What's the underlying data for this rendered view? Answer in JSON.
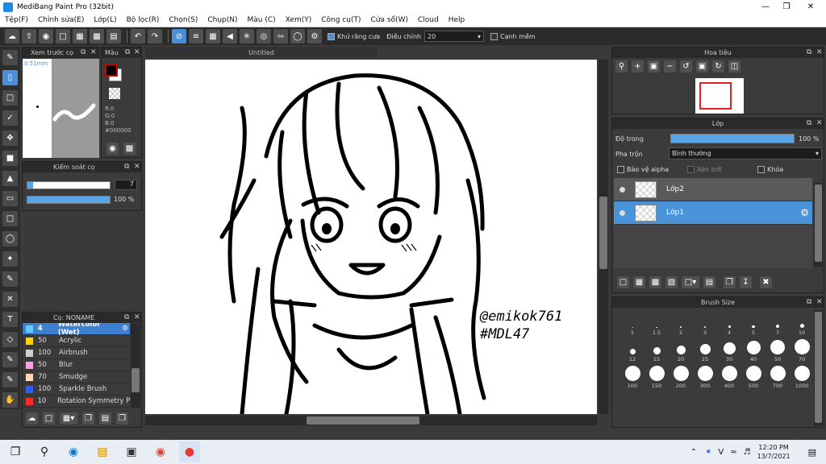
{
  "window": {
    "title": "MediBang Paint Pro (32bit)"
  },
  "menu": [
    "Tệp(F)",
    "Chỉnh sửa(E)",
    "Lớp(L)",
    "Bộ lọc(R)",
    "Chọn(S)",
    "Chụp(N)",
    "Màu (C)",
    "Xem(Y)",
    "Công cụ(T)",
    "Cửa sổ(W)",
    "Cloud",
    "Help"
  ],
  "toolbar": {
    "antialias_label": "Khử răng cưa",
    "adjust_label": "Điều chỉnh",
    "adjust_value": "20",
    "snap_label": "Cạnh mềm"
  },
  "brush_preview": {
    "title": "Xem trước cọ",
    "size": "0.51mm"
  },
  "color_panel": {
    "title": "Màu",
    "r": "R:0",
    "g": "G:0",
    "b": "B:0",
    "hex": "#000000",
    "fg_color": "#000000",
    "bg_color": "#ffffff"
  },
  "brush_control": {
    "title": "Kiểm soát cọ",
    "size_value": "7",
    "opacity_value": "100 %",
    "size_fraction": 0.07,
    "opacity_fraction": 1.0
  },
  "brush_list": {
    "title": "Cọ: NONAME",
    "items": [
      {
        "size": "4",
        "name": "Watercolor (Wet)",
        "color": "#6ec6ff",
        "selected": true
      },
      {
        "size": "50",
        "name": "Acrylic",
        "color": "#ffd400"
      },
      {
        "size": "100",
        "name": "Airbrush",
        "color": "#cfcfcf"
      },
      {
        "size": "50",
        "name": "Blur",
        "color": "#ff9ee6"
      },
      {
        "size": "70",
        "name": "Smudge",
        "color": "#ffd8b8"
      },
      {
        "size": "100",
        "name": "Sparkle Brush",
        "color": "#2f5bff"
      },
      {
        "size": "10",
        "name": "Rotation Symmetry Pe",
        "color": "#ff2a2a"
      }
    ]
  },
  "document": {
    "tab": "Untitled",
    "signature": "@emikok761\n#MDL47"
  },
  "navigator": {
    "title": "Hoa tiêu"
  },
  "layer_panel": {
    "title": "Lớp",
    "opacity_label": "Độ trong",
    "opacity_value": "100 %",
    "opacity_fraction": 1.0,
    "blend_label": "Pha trộn",
    "blend_value": "Bình thường",
    "protect_alpha": "Bảo vệ alpha",
    "clipping": "Xén bớt",
    "lock": "Khóa",
    "layers": [
      {
        "name": "Lớp2",
        "selected": false
      },
      {
        "name": "Lớp1",
        "selected": true
      }
    ]
  },
  "brush_size": {
    "title": "Brush Size",
    "sizes": [
      "1",
      "1.5",
      "2",
      "3",
      "4",
      "5",
      "7",
      "10",
      "12",
      "15",
      "20",
      "25",
      "30",
      "40",
      "50",
      "70",
      "100",
      "150",
      "200",
      "300",
      "400",
      "500",
      "700",
      "1000"
    ]
  },
  "clock": {
    "time": "12:20 PM",
    "date": "13/7/2021"
  }
}
